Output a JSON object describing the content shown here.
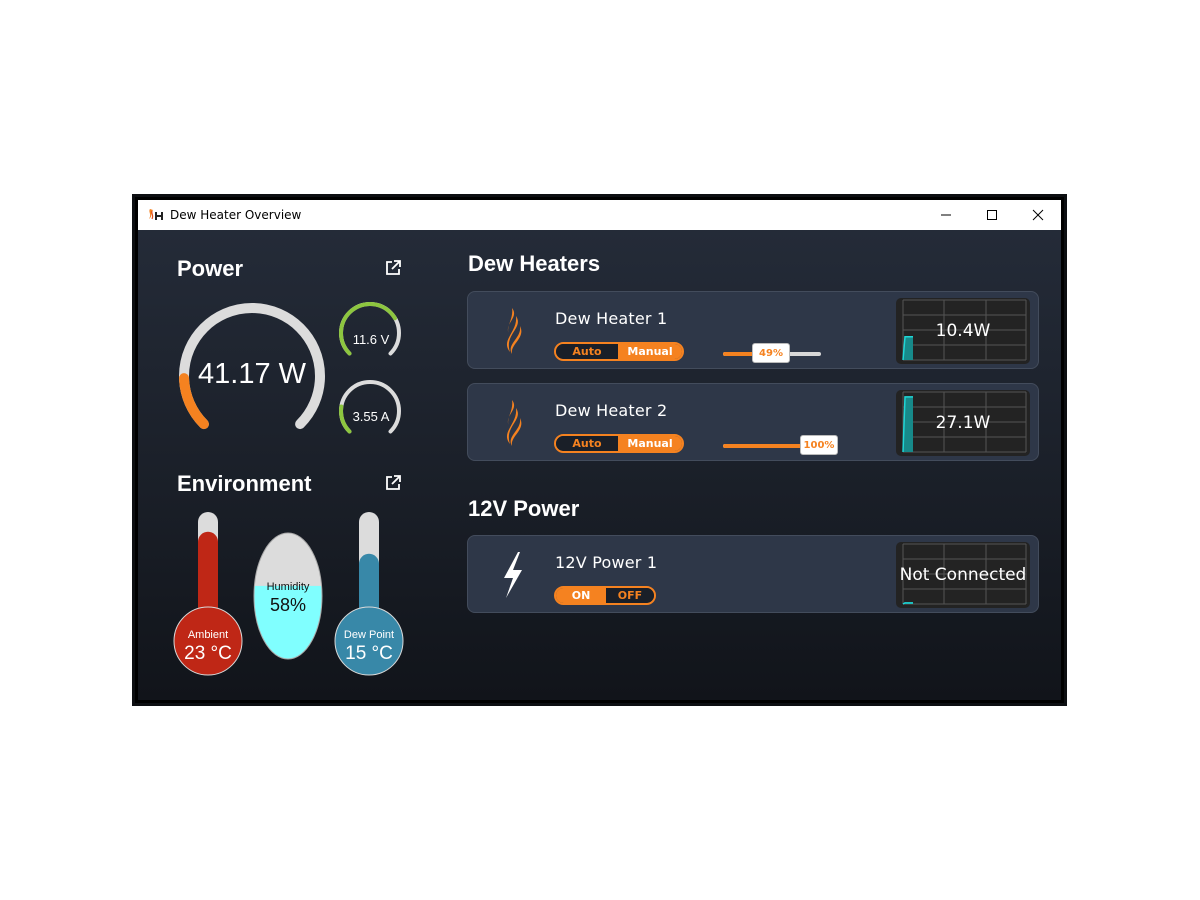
{
  "window": {
    "title": "Dew Heater Overview",
    "controls": {
      "minimize": "minimize-icon",
      "maximize": "maximize-icon",
      "close": "close-icon"
    }
  },
  "power": {
    "title": "Power",
    "main_gauge": {
      "label": "41.17 W",
      "fraction": 0.16,
      "color": "#f58220"
    },
    "voltage_gauge": {
      "label": "11.6 V",
      "fraction": 0.72,
      "color": "#8dc63f"
    },
    "current_gauge": {
      "label": "3.55 A",
      "fraction": 0.2,
      "color": "#8dc63f"
    }
  },
  "environment": {
    "title": "Environment",
    "ambient": {
      "label": "Ambient",
      "value": "23 °C",
      "fill": 0.82,
      "color": "#bf2716"
    },
    "humidity": {
      "label": "Humidity",
      "value": "58%",
      "fill": 0.58,
      "color": "#80ffff"
    },
    "dew_point": {
      "label": "Dew Point",
      "value": "15 °C",
      "fill": 0.62,
      "color": "#3888a8"
    }
  },
  "dew_heaters": {
    "title": "Dew Heaters",
    "items": [
      {
        "name": "Dew Heater 1",
        "mode_options": [
          "Auto",
          "Manual"
        ],
        "mode_selected": "Manual",
        "power_percent": 49,
        "power_percent_label": "49%",
        "reading": "10.4W",
        "history_fraction": 0.4
      },
      {
        "name": "Dew Heater 2",
        "mode_options": [
          "Auto",
          "Manual"
        ],
        "mode_selected": "Manual",
        "power_percent": 100,
        "power_percent_label": "100%",
        "reading": "27.1W",
        "history_fraction": 0.95
      }
    ]
  },
  "power_12v": {
    "title": "12V Power",
    "items": [
      {
        "name": "12V Power 1",
        "state_options": [
          "ON",
          "OFF"
        ],
        "state_selected": "ON",
        "reading": "Not Connected",
        "history_fraction": 0.02
      }
    ]
  },
  "colors": {
    "accent": "#f58220",
    "chart_line": "#1fd6d6",
    "card_bg": "#2e3748"
  }
}
